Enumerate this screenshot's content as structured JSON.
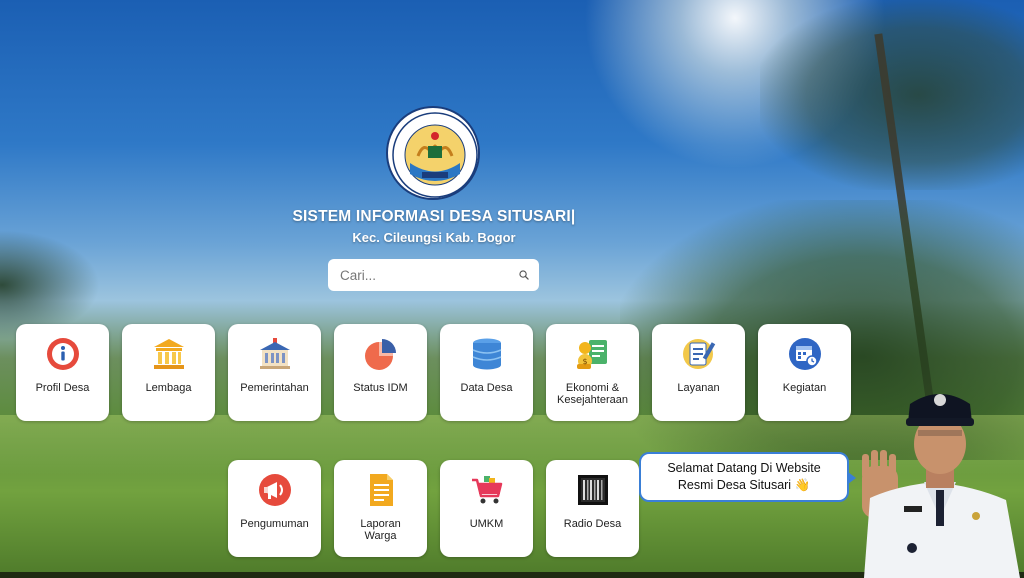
{
  "header": {
    "title": "SISTEM INFORMASI DESA SITUSARI|",
    "subtitle": "Kec. Cileungsi Kab. Bogor",
    "logo_icon": "village-seal-icon"
  },
  "search": {
    "placeholder": "Cari...",
    "icon": "search-icon"
  },
  "menu_row1": [
    {
      "label": "Profil Desa",
      "icon": "info-icon"
    },
    {
      "label": "Lembaga",
      "icon": "institution-icon"
    },
    {
      "label": "Pemerintahan",
      "icon": "government-building-icon"
    },
    {
      "label": "Status IDM",
      "icon": "pie-chart-icon"
    },
    {
      "label": "Data Desa",
      "icon": "database-icon"
    },
    {
      "label": "Ekonomi & Kesejahteraan",
      "icon": "economy-icon"
    },
    {
      "label": "Layanan",
      "icon": "service-icon"
    },
    {
      "label": "Kegiatan",
      "icon": "calendar-icon"
    }
  ],
  "menu_row2": [
    {
      "label": "Pengumuman",
      "icon": "megaphone-icon"
    },
    {
      "label": "Laporan Warga",
      "icon": "report-document-icon"
    },
    {
      "label": "UMKM",
      "icon": "shopping-cart-icon"
    },
    {
      "label": "Radio Desa",
      "icon": "radio-icon"
    }
  ],
  "greeting": {
    "line1": "Selamat Datang Di Website",
    "line2": "Resmi Desa Situsari 👋"
  },
  "colors": {
    "accent": "#3a7fd6",
    "seal_border": "#1a3d7c"
  }
}
